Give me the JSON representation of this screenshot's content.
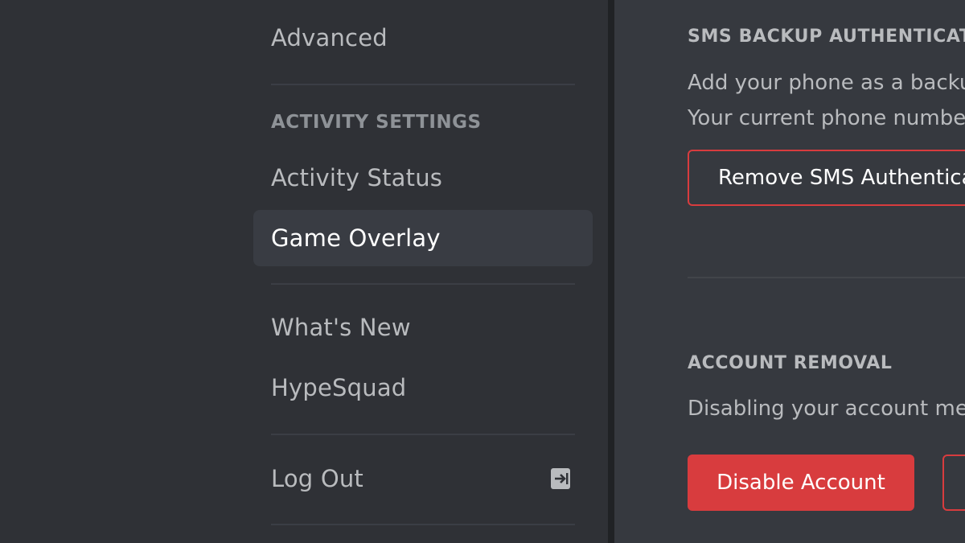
{
  "sidebar": {
    "items": [
      {
        "label": "Advanced"
      },
      {
        "label": "Activity Status"
      },
      {
        "label": "Game Overlay"
      },
      {
        "label": "What's New"
      },
      {
        "label": "HypeSquad"
      },
      {
        "label": "Log Out"
      }
    ],
    "activity_header": "ACTIVITY SETTINGS",
    "selected_item": "Game Overlay"
  },
  "main": {
    "sms": {
      "header": "SMS BACKUP AUTHENTICAT",
      "line1": "Add your phone as a backu",
      "line2": "Your current phone numbe",
      "remove_button": "Remove SMS Authentica"
    },
    "account_removal": {
      "header": "ACCOUNT REMOVAL",
      "description": "Disabling your account mea",
      "disable_button": "Disable Account"
    }
  },
  "icons": {
    "logout": "logout-arrow-icon"
  },
  "colors": {
    "sidebar_bg": "#2f3136",
    "main_bg": "#36393f",
    "selected_bg": "#393c43",
    "danger": "#d83c3e"
  }
}
